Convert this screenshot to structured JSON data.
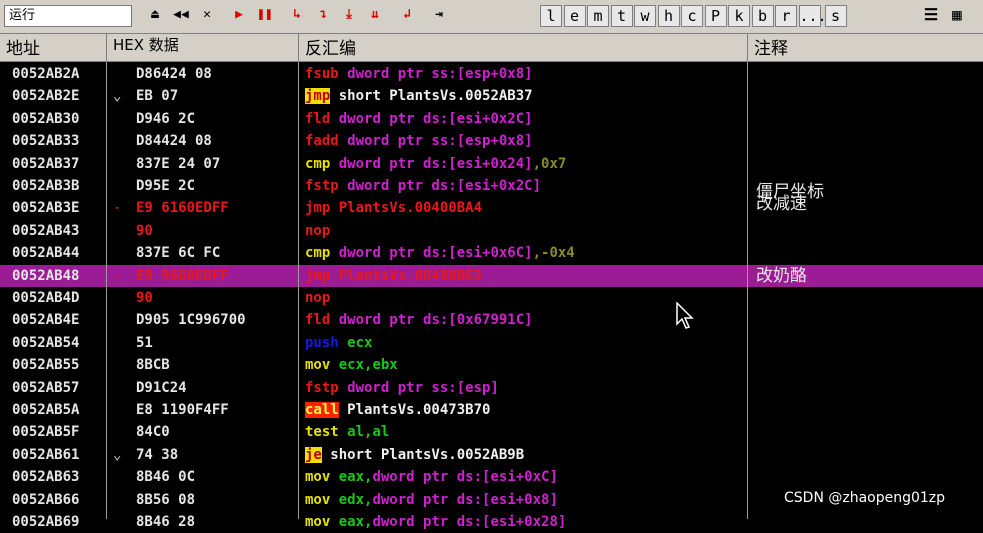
{
  "toolbar": {
    "status": "运行",
    "buttons": [
      {
        "label": "⏏",
        "name": "open-icon"
      },
      {
        "label": "◀◀",
        "name": "rewind-icon"
      },
      {
        "label": "✕",
        "name": "close-icon"
      },
      {
        "label": "▶",
        "name": "run-icon"
      },
      {
        "label": "❚❚",
        "name": "pause-icon"
      },
      {
        "label": "↳",
        "name": "step-into-icon"
      },
      {
        "label": "↴",
        "name": "step-over-icon"
      },
      {
        "label": "⤓",
        "name": "trace-into-icon"
      },
      {
        "label": "⇊",
        "name": "trace-over-icon"
      },
      {
        "label": "↲",
        "name": "execute-till-return-icon"
      },
      {
        "label": "⇥",
        "name": "goto-icon"
      }
    ],
    "letters": [
      "l",
      "e",
      "m",
      "t",
      "w",
      "h",
      "c",
      "P",
      "k",
      "b",
      "r",
      "...",
      "s"
    ],
    "extra": [
      {
        "label": "☰",
        "name": "list-icon"
      },
      {
        "label": "▦",
        "name": "options-icon"
      }
    ]
  },
  "header": {
    "addr": "地址",
    "hex": "HEX 数据",
    "dis": "反汇编",
    "cmt": "注释"
  },
  "rows": [
    {
      "addr": "0052AB2A",
      "mark": "",
      "hex": "D86424 08",
      "dis": [
        [
          "fsub",
          "c-red"
        ],
        [
          " dword ptr ss:[esp+0x8]",
          "c-mag"
        ]
      ],
      "cmt": ""
    },
    {
      "addr": "0052AB2E",
      "mark": "⌄",
      "hex": "EB 07",
      "dis": [
        [
          "jmp",
          "hl-y"
        ],
        [
          " short PlantsVs.0052AB37",
          "c-wht"
        ]
      ],
      "cmt": ""
    },
    {
      "addr": "0052AB30",
      "mark": "",
      "hex": "D946 2C",
      "dis": [
        [
          "fld",
          "c-red"
        ],
        [
          " dword ptr ds:[esi+0x2C]",
          "c-mag"
        ]
      ],
      "cmt": ""
    },
    {
      "addr": "0052AB33",
      "mark": "",
      "hex": "D84424 08",
      "dis": [
        [
          "fadd",
          "c-red"
        ],
        [
          " dword ptr ss:[esp+0x8]",
          "c-mag"
        ]
      ],
      "cmt": ""
    },
    {
      "addr": "0052AB37",
      "mark": "",
      "hex": "837E 24 07",
      "dis": [
        [
          "cmp",
          "c-yel"
        ],
        [
          " dword ptr ds:[esi+0x24]",
          "c-mag"
        ],
        [
          ",0x7",
          "c-olive"
        ]
      ],
      "cmt": ""
    },
    {
      "addr": "0052AB3B",
      "mark": "",
      "hex": "D95E 2C",
      "dis": [
        [
          "fstp",
          "c-red"
        ],
        [
          " dword ptr ds:[esi+0x2C]",
          "c-mag"
        ]
      ],
      "cmt": "僵尸坐标"
    },
    {
      "addr": "0052AB3E",
      "mark": "-",
      "hex": "E9 6160EDFF",
      "hexcls": "c-red",
      "dis": [
        [
          "jmp PlantsVs.00400BA4",
          "c-red"
        ]
      ],
      "cmt": "改减速"
    },
    {
      "addr": "0052AB43",
      "mark": "",
      "hex": "90",
      "hexcls": "c-red",
      "dis": [
        [
          "nop",
          "c-red"
        ]
      ],
      "cmt": ""
    },
    {
      "addr": "0052AB44",
      "mark": "",
      "hex": "837E 6C FC",
      "dis": [
        [
          "cmp",
          "c-yel"
        ],
        [
          " dword ptr ds:[esi+0x6C]",
          "c-mag"
        ],
        [
          ",-0x4",
          "c-olive"
        ]
      ],
      "cmt": ""
    },
    {
      "addr": "0052AB48",
      "mark": "-",
      "hex": "E9 9660EDFF",
      "hexcls": "c-red",
      "dis": [
        [
          "jmp PlantsVs.00400BE3",
          "c-red"
        ]
      ],
      "cmt": "改奶酪",
      "sel": true
    },
    {
      "addr": "0052AB4D",
      "mark": "",
      "hex": "90",
      "hexcls": "c-red",
      "dis": [
        [
          "nop",
          "c-red"
        ]
      ],
      "cmt": ""
    },
    {
      "addr": "0052AB4E",
      "mark": "",
      "hex": "D905 1C996700",
      "dis": [
        [
          "fld",
          "c-red"
        ],
        [
          " dword ptr ds:[0x67991C]",
          "c-mag"
        ]
      ],
      "cmt": ""
    },
    {
      "addr": "0052AB54",
      "mark": "",
      "hex": "51",
      "dis": [
        [
          "push",
          "c-blu"
        ],
        [
          " ecx",
          "c-grn"
        ]
      ],
      "cmt": ""
    },
    {
      "addr": "0052AB55",
      "mark": "",
      "hex": "8BCB",
      "dis": [
        [
          "mov",
          "c-yel"
        ],
        [
          " ecx,ebx",
          "c-grn"
        ]
      ],
      "cmt": ""
    },
    {
      "addr": "0052AB57",
      "mark": "",
      "hex": "D91C24",
      "dis": [
        [
          "fstp",
          "c-red"
        ],
        [
          " dword ptr ss:[esp]",
          "c-mag"
        ]
      ],
      "cmt": ""
    },
    {
      "addr": "0052AB5A",
      "mark": "",
      "hex": "E8 1190F4FF",
      "dis": [
        [
          "call",
          "hl-r"
        ],
        [
          " PlantsVs.00473B70",
          "c-wht"
        ]
      ],
      "cmt": ""
    },
    {
      "addr": "0052AB5F",
      "mark": "",
      "hex": "84C0",
      "dis": [
        [
          "test",
          "c-yel"
        ],
        [
          " al,al",
          "c-grn"
        ]
      ],
      "cmt": ""
    },
    {
      "addr": "0052AB61",
      "mark": "⌄",
      "hex": "74 38",
      "dis": [
        [
          "je",
          "hl-y"
        ],
        [
          " short PlantsVs.0052AB9B",
          "c-wht"
        ]
      ],
      "cmt": ""
    },
    {
      "addr": "0052AB63",
      "mark": "",
      "hex": "8B46 0C",
      "dis": [
        [
          "mov",
          "c-yel"
        ],
        [
          " eax,",
          "c-grn"
        ],
        [
          "dword ptr ds:[esi+0xC]",
          "c-mag"
        ]
      ],
      "cmt": ""
    },
    {
      "addr": "0052AB66",
      "mark": "",
      "hex": "8B56 08",
      "dis": [
        [
          "mov",
          "c-yel"
        ],
        [
          " edx,",
          "c-grn"
        ],
        [
          "dword ptr ds:[esi+0x8]",
          "c-mag"
        ]
      ],
      "cmt": ""
    },
    {
      "addr": "0052AB69",
      "mark": "",
      "hex": "8B46 28",
      "dis": [
        [
          "mov",
          "c-yel"
        ],
        [
          " eax,",
          "c-grn"
        ],
        [
          "dword ptr ds:[esi+0x28]",
          "c-mag"
        ]
      ],
      "cmt": ""
    }
  ],
  "watermark": "CSDN @zhaopeng01zp",
  "colors": {
    "selection": "#9b1c95",
    "background": "#000000",
    "toolbar": "#d4d0c8"
  }
}
